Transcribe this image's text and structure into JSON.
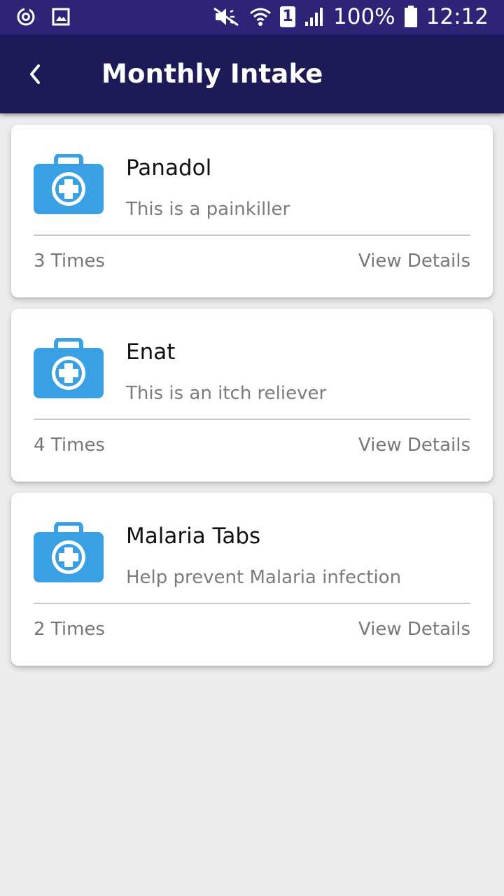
{
  "status_bar": {
    "battery": "100%",
    "time": "12:12",
    "sim_slot": "1",
    "icons": [
      "sync-icon",
      "image-icon",
      "mute-icon",
      "wifi-icon",
      "sim-icon",
      "signal-icon",
      "battery-icon"
    ]
  },
  "app_bar": {
    "title": "Monthly Intake",
    "back_icon": "chevron-left-icon",
    "color": "#1d1a58"
  },
  "colors": {
    "status_bar": "#2b2477",
    "icon_blue": "#3aa0e4",
    "background": "#ececec"
  },
  "medications": [
    {
      "name": "Panadol",
      "description": "This is a painkiller",
      "times": "3 Times",
      "action": "View Details",
      "icon": "medical-kit-icon"
    },
    {
      "name": "Enat",
      "description": "This is an itch reliever",
      "times": "4 Times",
      "action": "View Details",
      "icon": "medical-kit-icon"
    },
    {
      "name": "Malaria Tabs",
      "description": "Help prevent Malaria infection",
      "times": "2 Times",
      "action": "View Details",
      "icon": "medical-kit-icon"
    }
  ]
}
